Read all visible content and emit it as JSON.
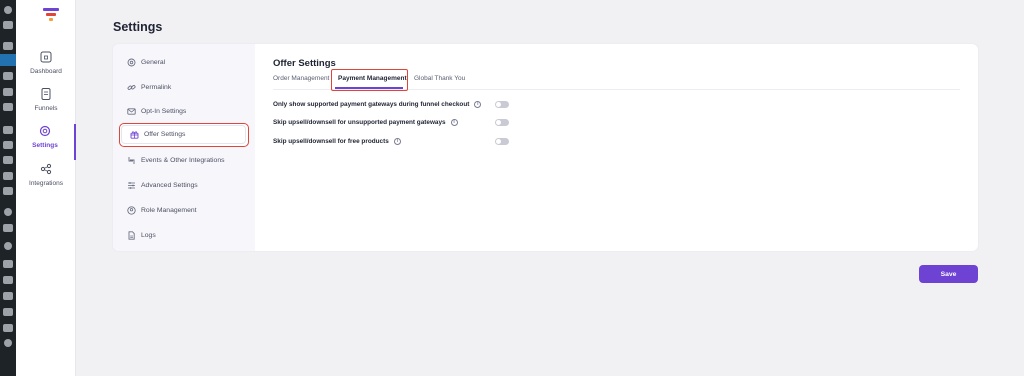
{
  "page": {
    "title": "Settings"
  },
  "nav": {
    "items": [
      {
        "label": "Dashboard",
        "icon": "home-icon"
      },
      {
        "label": "Funnels",
        "icon": "funnels-icon"
      },
      {
        "label": "Settings",
        "icon": "gear-icon",
        "active": true
      },
      {
        "label": "Integrations",
        "icon": "share-icon"
      }
    ]
  },
  "settings_menu": {
    "items": [
      {
        "label": "General",
        "icon": "gear-icon"
      },
      {
        "label": "Permalink",
        "icon": "link-icon"
      },
      {
        "label": "Opt-In Settings",
        "icon": "mail-icon"
      },
      {
        "label": "Offer Settings",
        "icon": "gift-icon",
        "active": true
      },
      {
        "label": "Events & Other Integrations",
        "icon": "sync-icon"
      },
      {
        "label": "Advanced Settings",
        "icon": "sliders-icon"
      },
      {
        "label": "Role Management",
        "icon": "user-icon"
      },
      {
        "label": "Logs",
        "icon": "file-icon"
      }
    ]
  },
  "content": {
    "title": "Offer Settings",
    "tabs": [
      {
        "label": "Order Management"
      },
      {
        "label": "Payment Management",
        "active": true
      },
      {
        "label": "Global Thank You"
      }
    ],
    "options": [
      {
        "label": "Only show supported payment gateways during funnel checkout",
        "enabled": false
      },
      {
        "label": "Skip upsell/downsell for unsupported payment gateways",
        "enabled": false
      },
      {
        "label": "Skip upsell/downsell for free products",
        "enabled": false
      }
    ]
  },
  "actions": {
    "save_label": "Save"
  },
  "colors": {
    "accent": "#6e42d3",
    "highlight": "#e0453a"
  }
}
